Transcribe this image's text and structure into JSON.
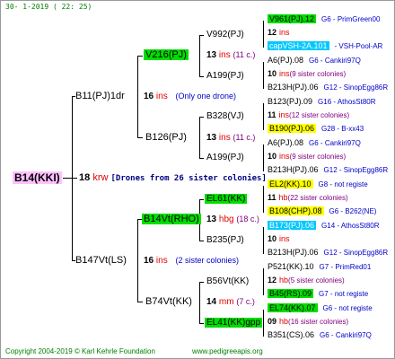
{
  "header": "30-  1-2019 ( 22: 25)",
  "footer": {
    "copyright": "Copyright 2004-2019 © Karl Kehrle Foundation",
    "site": "www.pedigreeapis.org"
  },
  "root": {
    "label": "B14(KKI)",
    "num": "18",
    "suffix": "krw",
    "note": "[Drones from 26 sister colonies]"
  },
  "g1a": {
    "label": "B11(PJ)1dr",
    "num": "16",
    "suffix": "ins",
    "note": "(Only one drone)"
  },
  "g1b": {
    "label": "B147Vt(LS)",
    "num": "16",
    "suffix": "ins",
    "note": "(2 sister colonies)"
  },
  "g2a": {
    "label": "V216(PJ)",
    "num": "13",
    "suffix": "ins",
    "note": "(11 c.)"
  },
  "g2b": {
    "label": "B126(PJ)",
    "num": "13",
    "suffix": "ins",
    "note": "(11 c.)"
  },
  "g2c": {
    "label": "B14Vt(RHO)",
    "num": "13",
    "suffix": "hbg",
    "note": "(18 c.)"
  },
  "g2d": {
    "label": "B74Vt(KK)",
    "num": "14",
    "suffix": "mm",
    "note": "(7 c.)"
  },
  "g3": [
    {
      "label": "V992(PJ)"
    },
    {
      "label": "A199(PJ)"
    },
    {
      "label": "B328(VJ)"
    },
    {
      "label": "A199(PJ)"
    },
    {
      "label": "EL61(KK)"
    },
    {
      "label": "B235(PJ)"
    },
    {
      "label": "B56Vt(KK)"
    },
    {
      "label": "EL41(KK)gpp"
    }
  ],
  "g4": [
    {
      "label": "V961(PJ).12",
      "info": "G6 - PrimGreen00"
    },
    {
      "num": "12",
      "suffix": "ins",
      "note": ""
    },
    {
      "label": "capVSH-2A.101",
      "info": "- VSH-Pool-AR"
    },
    {
      "label": "A6(PJ).08",
      "info": "G6 - Cankiri97Q"
    },
    {
      "num": "10",
      "suffix": "ins",
      "note": "(9 sister colonies)"
    },
    {
      "label": "B213H(PJ).06",
      "info": "G12 - SinopEgg86R"
    },
    {
      "label": "B123(PJ).09",
      "info": "G16 - AthosSt80R"
    },
    {
      "num": "11",
      "suffix": "ins",
      "note": "(12 sister colonies)"
    },
    {
      "label": "B190(PJ).06",
      "info": "G28 - B-xx43"
    },
    {
      "label": "A6(PJ).08",
      "info": "G6 - Cankiri97Q"
    },
    {
      "num": "10",
      "suffix": "ins",
      "note": "(9 sister colonies)"
    },
    {
      "label": "B213H(PJ).06",
      "info": "G12 - SinopEgg86R"
    },
    {
      "label": "EL2(KK).10",
      "info": "G8 - not registe"
    },
    {
      "num": "11",
      "suffix": "hb",
      "note": "(22 sister colonies)"
    },
    {
      "label": "B108(CHP).08",
      "info": "G6 - B262(NE)"
    },
    {
      "label": "B173(PJ).06",
      "info": "G14 - AthosSt80R"
    },
    {
      "num": "10",
      "suffix": "ins",
      "note": ""
    },
    {
      "label": "B213H(PJ).06",
      "info": "G12 - SinopEgg86R"
    },
    {
      "label": "P521(KK).10",
      "info": "G7 - PrimRed01"
    },
    {
      "num": "12",
      "suffix": "hb",
      "note": "(5 sister colonies)"
    },
    {
      "label": "B45(RS).09",
      "info": "G7 - not registe"
    },
    {
      "label": "EL74(KK).07",
      "info": "G6 - not registe"
    },
    {
      "num": "09",
      "suffix": "hb",
      "note": "(16 sister colonies)"
    },
    {
      "label": "B351(CS).06",
      "info": "G6 - Cankiri97Q"
    }
  ]
}
